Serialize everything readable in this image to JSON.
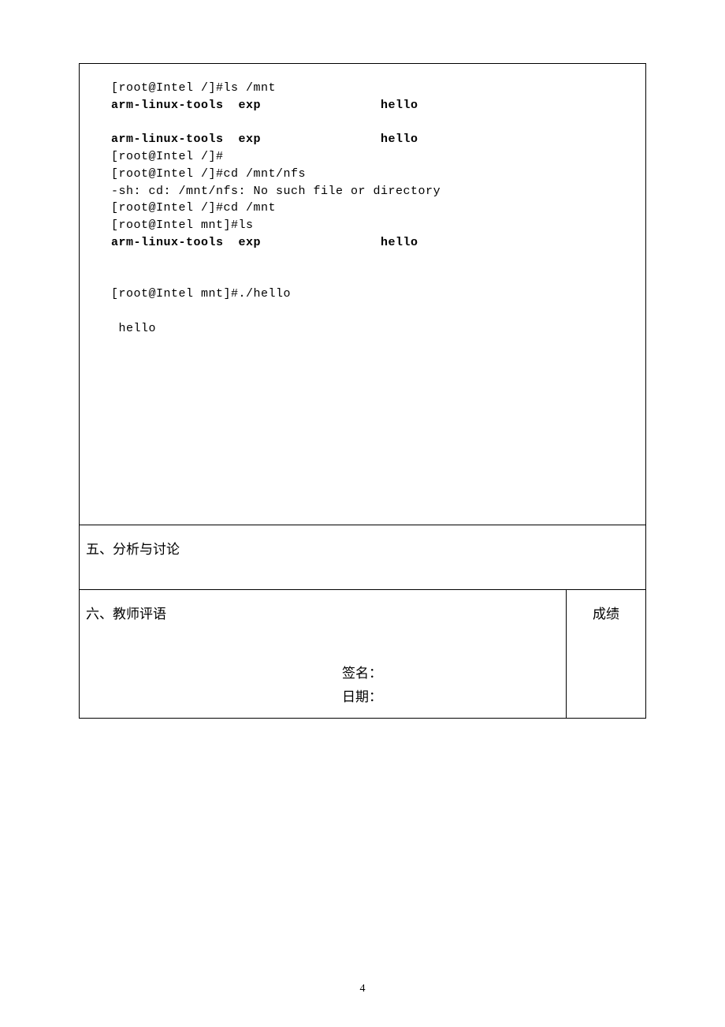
{
  "terminal": {
    "l1": "[root@Intel /]#ls /mnt",
    "l2a": "arm-linux-tools  exp",
    "l2b": "                hello",
    "l3a": "arm-linux-tools  exp",
    "l3b": "                hello",
    "l4": "[root@Intel /]#",
    "l5": "[root@Intel /]#cd /mnt/nfs",
    "l6": "-sh: cd: /mnt/nfs: No such file or directory",
    "l7": "[root@Intel /]#cd /mnt",
    "l8": "[root@Intel mnt]#ls",
    "l9a": "arm-linux-tools  exp",
    "l9b": "                hello",
    "l10": "[root@Intel mnt]#./hello",
    "l11": " hello"
  },
  "sections": {
    "s5": "五、分析与讨论",
    "s6": "六、教师评语",
    "grade": "成绩",
    "sign": "签名：",
    "date": "日期："
  },
  "pagenum": "4"
}
